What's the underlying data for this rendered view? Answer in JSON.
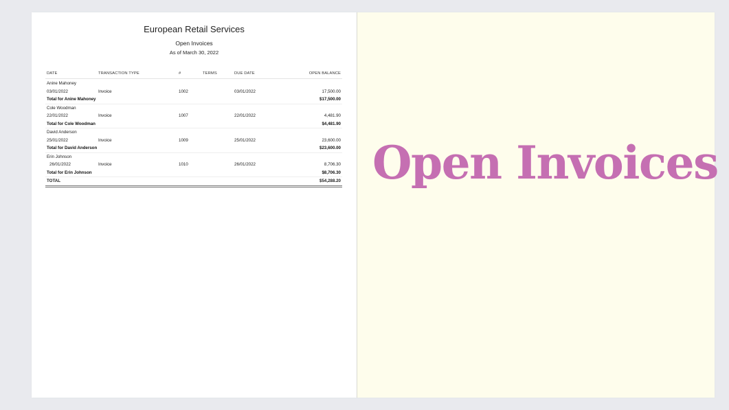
{
  "report": {
    "company": "European Retail Services",
    "name": "Open Invoices",
    "as_of": "As of March 30, 2022",
    "columns": {
      "date": "DATE",
      "type": "TRANSACTION TYPE",
      "num": "#",
      "terms": "TERMS",
      "due": "DUE DATE",
      "balance": "OPEN BALANCE"
    },
    "groups": [
      {
        "customer": "Anine Mahoney",
        "date": "03/01/2022",
        "type": "Invoice",
        "num": "1002",
        "due": "03/01/2022",
        "balance": "17,500.00",
        "total_label": "Total for Anine Mahoney",
        "total": "$17,500.00"
      },
      {
        "customer": "Cole Woodman",
        "date": "22/01/2022",
        "type": "Invoice",
        "num": "1007",
        "due": "22/01/2022",
        "balance": "4,481.90",
        "total_label": "Total for Cole Woodman",
        "total": "$4,481.90"
      },
      {
        "customer": "David Anderson",
        "date": "25/01/2022",
        "type": "Invoice",
        "num": "1009",
        "due": "25/01/2022",
        "balance": "23,600.00",
        "total_label": "Total for David Anderson",
        "total": "$23,600.00"
      },
      {
        "customer": "Erin Johnson",
        "date": "26/01/2022",
        "type": "Invoice",
        "num": "1010",
        "due": "26/01/2022",
        "balance": "8,706.30",
        "total_label": "Total for Erin Johnson",
        "total": "$8,706.30"
      }
    ],
    "grand_total_label": "TOTAL",
    "grand_total": "$54,288.20"
  },
  "slide_title": "Open Invoices",
  "colors": {
    "title": "#c56fb2",
    "right_panel_bg": "#fefdec",
    "page_bg": "#e9eaee"
  }
}
